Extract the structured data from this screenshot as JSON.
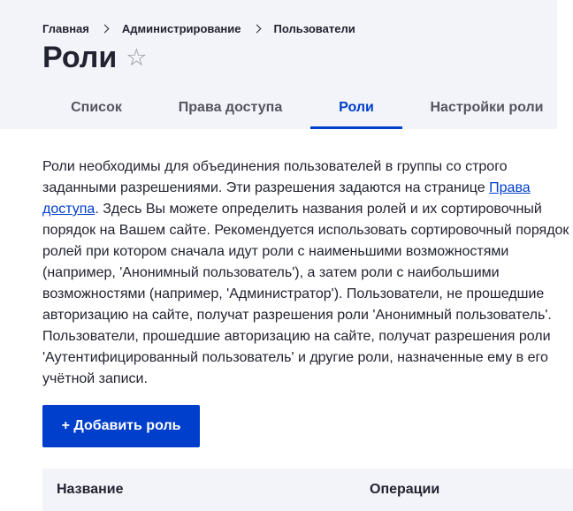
{
  "breadcrumb": [
    "Главная",
    "Администрирование",
    "Пользователи"
  ],
  "page_title": "Роли",
  "favorite_icon": "star-outline-icon",
  "tabs": [
    {
      "label": "Список",
      "active": false
    },
    {
      "label": "Права доступа",
      "active": false
    },
    {
      "label": "Роли",
      "active": true
    },
    {
      "label": "Настройки роли",
      "active": false
    }
  ],
  "description": {
    "part1": "Роли необходимы для объединения пользователей в группы со строго заданными разрешениями. Эти разрешения задаются на странице ",
    "link": "Права доступа",
    "part2": ". Здесь Вы можете определить названия ролей и их сортировочный порядок на Вашем сайте. Рекомендуется использовать сортировочный порядок ролей при котором сначала идут роли с наименьшими возможностями (например, 'Анонимный пользователь'), а затем роли с наибольшими возможностями (например, 'Администратор'). Пользователи, не прошедшие авторизацию на сайте, получат разрешения роли 'Анонимный пользователь'. Пользователи, прошедшие авторизацию на сайте, получат разрешения роли 'Аутентифицированный пользователь' и другие роли, назначенные ему в его учётной записи."
  },
  "add_button_label": "+ Добавить роль",
  "table": {
    "columns": [
      "Название",
      "Операции"
    ]
  },
  "colors": {
    "accent": "#003ecc",
    "header_bg": "#f3f4f9",
    "text": "#222330"
  }
}
